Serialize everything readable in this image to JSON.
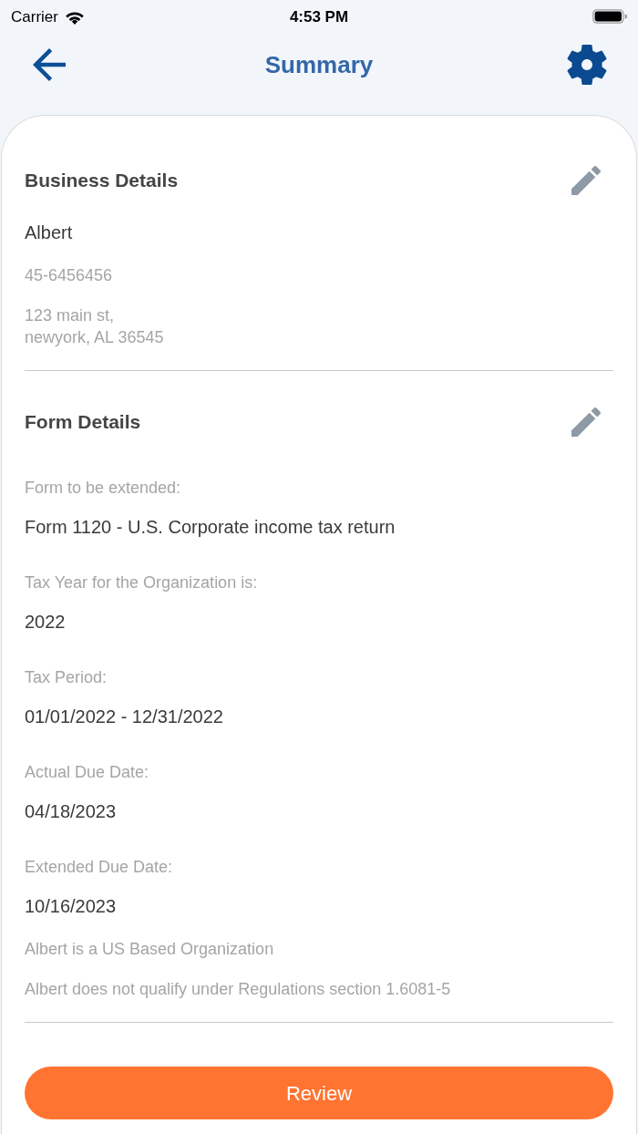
{
  "status_bar": {
    "carrier": "Carrier",
    "time": "4:53 PM"
  },
  "header": {
    "title": "Summary"
  },
  "sections": [
    {
      "title": "Business Details",
      "rows": [
        {
          "kind": "value",
          "text": "Albert"
        },
        {
          "kind": "note",
          "text": "45-6456456"
        },
        {
          "kind": "note",
          "text": "123 main st,\nnewyork, AL 36545"
        }
      ]
    },
    {
      "title": "Form Details",
      "rows": [
        {
          "kind": "label",
          "text": "Form to be extended:"
        },
        {
          "kind": "value",
          "text": "Form 1120 - U.S. Corporate income tax return"
        },
        {
          "kind": "label",
          "text": "Tax Year for the Organization is:"
        },
        {
          "kind": "value",
          "text": "2022"
        },
        {
          "kind": "label",
          "text": "Tax Period:"
        },
        {
          "kind": "value",
          "text": "01/01/2022 - 12/31/2022"
        },
        {
          "kind": "label",
          "text": "Actual Due Date:"
        },
        {
          "kind": "value",
          "text": "04/18/2023"
        },
        {
          "kind": "label",
          "text": "Extended Due Date:"
        },
        {
          "kind": "value",
          "text": "10/16/2023"
        },
        {
          "kind": "note",
          "text": "Albert is a US Based Organization"
        },
        {
          "kind": "note",
          "text": "Albert does not qualify under Regulations section 1.6081-5"
        }
      ]
    }
  ],
  "primary_button": {
    "label": "Review"
  }
}
